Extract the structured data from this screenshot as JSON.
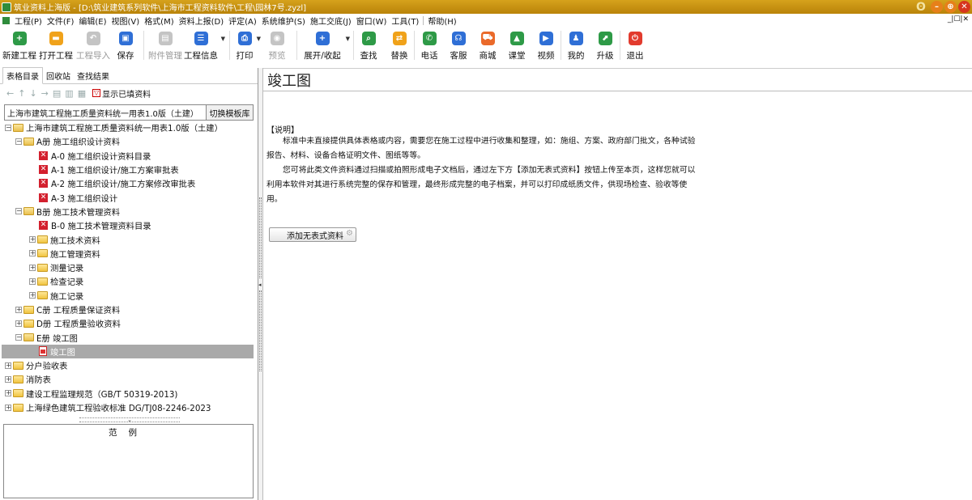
{
  "window": {
    "title": "筑业资料上海版 - [D:\\筑业建筑系列软件\\上海市工程资料软件\\工程\\园林7号.zyzl]"
  },
  "menu": {
    "items": [
      "工程(P)",
      "文件(F)",
      "编辑(E)",
      "视图(V)",
      "格式(M)",
      "资料上报(D)",
      "评定(A)",
      "系统维护(S)",
      "施工交底(J)",
      "窗口(W)",
      "工具(T)",
      "帮助(H)"
    ],
    "mdi_controls": "_|☐|✕"
  },
  "toolbar": {
    "new_project": "新建工程",
    "open_project": "打开工程",
    "import_project": "工程导入",
    "save": "保存",
    "attachment": "附件管理",
    "project_info": "工程信息",
    "print": "打印",
    "preview": "预览",
    "expand_collapse": "展开/收起",
    "find": "查找",
    "replace": "替换",
    "phone": "电话",
    "service": "客服",
    "mall": "商城",
    "classroom": "课堂",
    "video": "视频",
    "mine": "我的",
    "upgrade": "升级",
    "exit": "退出"
  },
  "left": {
    "tabs": [
      "表格目录",
      "回收站",
      "查找结果"
    ],
    "show_filled": "显示已填资料",
    "template_select": "上海市建筑工程施工质量资料统一用表1.0版（土建）",
    "switch_template": "切换模板库",
    "tree": {
      "root": "上海市建筑工程施工质量资料统一用表1.0版（土建）",
      "a_book": "A册 施工组织设计资料",
      "a0": "A-0 施工组织设计资料目录",
      "a1": "A-1 施工组织设计/施工方案审批表",
      "a2": "A-2 施工组织设计/施工方案修改审批表",
      "a3": "A-3 施工组织设计",
      "b_book": "B册 施工技术管理资料",
      "b0": "B-0 施工技术管理资料目录",
      "b_tech": "施工技术资料",
      "b_mgmt": "施工管理资料",
      "b_survey": "测量记录",
      "b_check": "检查记录",
      "b_record": "施工记录",
      "c_book": "C册 工程质量保证资料",
      "d_book": "D册 工程质量验收资料",
      "e_book": "E册 竣工图",
      "e_item": "竣工图",
      "fenhu": "分户验收表",
      "xiaofang": "消防表",
      "jianli": "建设工程监理规范（GB/T 50319-2013)",
      "lvse": "上海绿色建筑工程验收标准 DG/TJ08-2246-2023"
    },
    "legend_title": "范例"
  },
  "right": {
    "title": "竣工图",
    "desc_head": "【说明】",
    "para1": "标准中未直接提供具体表格或内容，需要您在施工过程中进行收集和整理，如：施组、方案、政府部门批文，各种试验报告、材料、设备合格证明文件、图纸等等。",
    "para2": "您可将此类文件资料通过扫描或拍照形成电子文档后，通过左下方【添加无表式资料】按钮上传至本页，这样您就可以利用本软件对其进行系统完整的保存和管理，最终形成完整的电子档案，并可以打印成纸质文件，供现场检查、验收等使用。",
    "add_button": "添加无表式资料"
  },
  "colors": {
    "titlebar": "#c08b0e",
    "selected_row": "#a9a9a9",
    "error_icon": "#d3202e"
  }
}
